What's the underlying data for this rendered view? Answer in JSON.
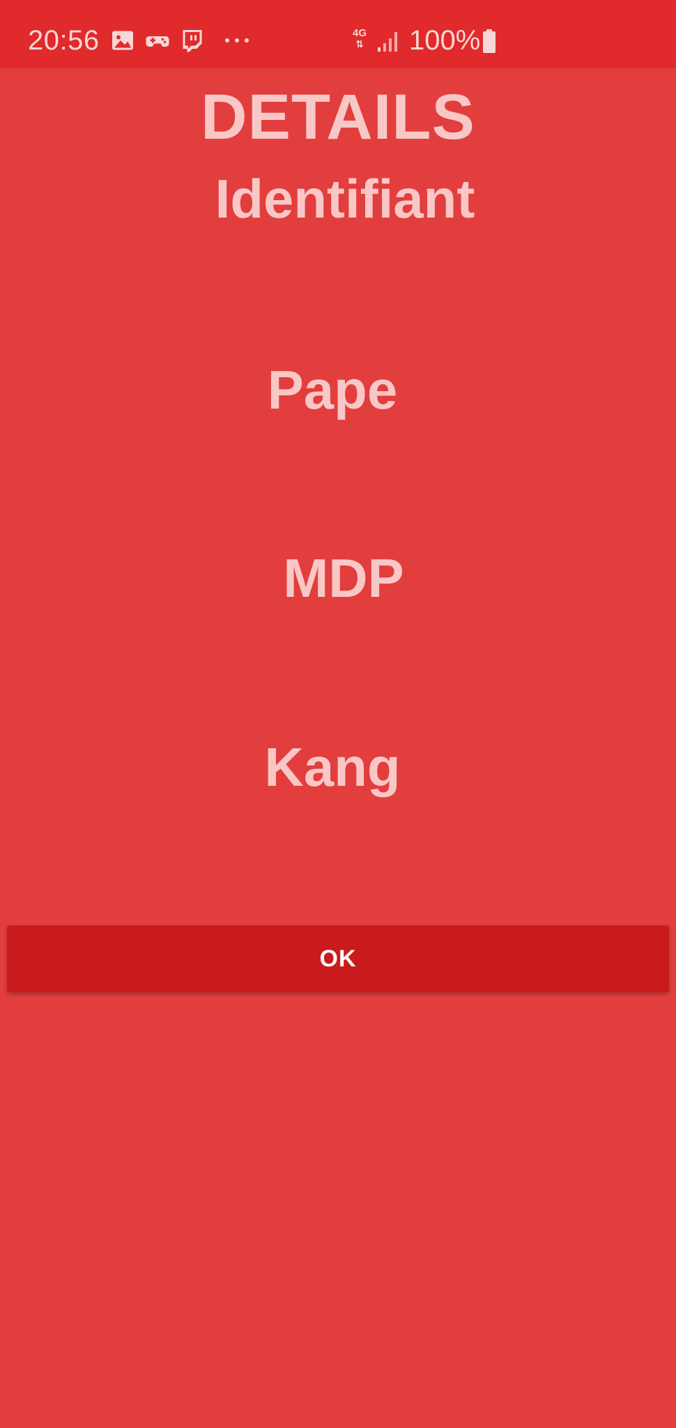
{
  "status_bar": {
    "time": "20:56",
    "network": "4G",
    "battery": "100%",
    "icons": [
      "gallery-icon",
      "game-controller-icon",
      "twitch-icon",
      "more-dots-icon",
      "network-4g-icon",
      "signal-icon",
      "battery-icon"
    ]
  },
  "screen": {
    "title": "DETAILS",
    "label": "Identifiant",
    "values": [
      "Pape",
      "MDP",
      "Kang"
    ]
  },
  "actions": {
    "ok_label": "OK"
  },
  "colors": {
    "background": "#E23E3E",
    "status_bar": "#E02A2B",
    "text": "#F8C7C6",
    "button": "#C91B1B",
    "button_text": "#FFFFFF"
  }
}
